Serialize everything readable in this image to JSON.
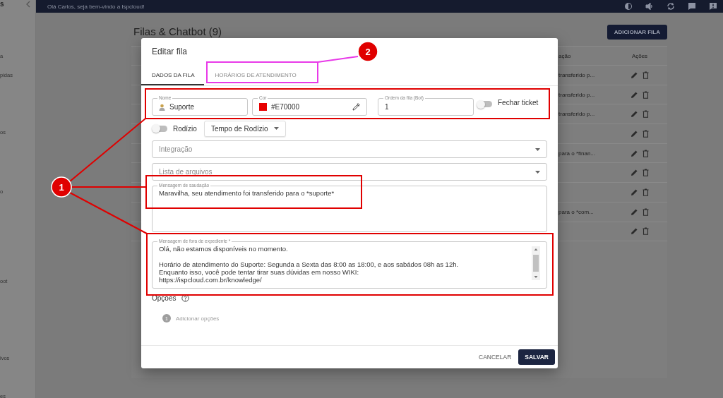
{
  "sidebar": {
    "logo": "s",
    "items": [
      {
        "label": "a"
      },
      {
        "label": "pidas"
      },
      {
        "label": "os"
      },
      {
        "label": "o"
      },
      {
        "label": "oot"
      },
      {
        "label": "ivos"
      },
      {
        "label": "es"
      }
    ]
  },
  "top_bar": {
    "greeting": "Olá Carlos, seja bem-vindo a Ispcloud!"
  },
  "page": {
    "title": "Filas & Chatbot (9)",
    "add_button": "ADICIONAR FILA"
  },
  "table": {
    "columns": [
      "ação",
      "Ações"
    ],
    "rows": [
      {
        "kind": "message",
        "message": "transferido p..."
      },
      {
        "kind": "message",
        "message": "transferido p..."
      },
      {
        "kind": "message",
        "message": "transferido p..."
      },
      {
        "kind": "blank"
      },
      {
        "kind": "message",
        "message": "para o *finan..."
      },
      {
        "kind": "blank"
      },
      {
        "kind": "blank"
      },
      {
        "kind": "message",
        "message": "para o *com..."
      },
      {
        "kind": "blank"
      }
    ]
  },
  "dialog": {
    "title": "Editar fila",
    "tabs": [
      {
        "label": "DADOS DA FILA",
        "selected": true
      },
      {
        "label": "HORÁRIOS DE ATENDIMENTO",
        "selected": false
      }
    ],
    "name": {
      "label": "Nome",
      "value": "Suporte"
    },
    "color": {
      "label": "Cor",
      "value": "#E70000"
    },
    "order": {
      "label": "Ordem da fila (Bot)",
      "value": "1"
    },
    "close_ticket": {
      "label": "Fechar ticket",
      "on": false
    },
    "rotation": {
      "label": "Rodízio",
      "on": false
    },
    "rotation_time": {
      "label": "Tempo de Rodízio"
    },
    "integration": {
      "placeholder": "Integração"
    },
    "file_list": {
      "placeholder": "Lista de arquivos"
    },
    "greeting_message": {
      "label": "Mensagem de saudação",
      "value": "Maravilha, seu atendimento foi transferido para o *suporte*"
    },
    "off_hours_message": {
      "label": "Mensagem de fora de expediente *",
      "value": "Olá, não estamos disponíveis no momento.\n\nHorário de atendimento do Suporte: Segunda a Sexta das 8:00 as 18:00, e aos sabádos 08h as 12h.\nEnquanto isso, você pode tentar tirar suas dúvidas em nosso WIKI:\nhttps://ispcloud.com.br/knowledge/"
    },
    "options": {
      "label": "Opções",
      "steps": [
        {
          "number": "1",
          "label": "Adicionar opções"
        }
      ]
    },
    "buttons": [
      {
        "kind": "text",
        "label": "CANCELAR"
      },
      {
        "kind": "primary",
        "label": "SALVAR"
      }
    ]
  },
  "annotations": [
    {
      "label": "1"
    },
    {
      "label": "2"
    }
  ]
}
